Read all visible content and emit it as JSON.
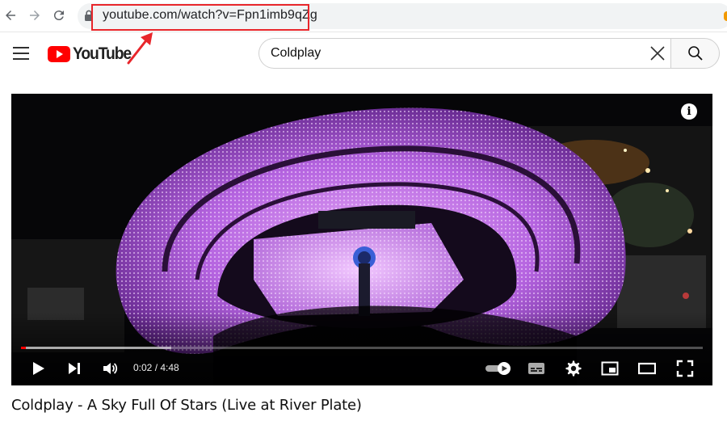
{
  "browser": {
    "url": "youtube.com/watch?v=Fpn1imb9qZg",
    "highlight_color": "#e8262b"
  },
  "header": {
    "logo_text": "YouTube",
    "brand_color": "#ff0000",
    "search": {
      "value": "Coldplay"
    }
  },
  "player": {
    "current_time": "0:02",
    "duration": "4:48",
    "time_display": "0:02 / 4:48",
    "progress_fraction": 0.007,
    "buffered_fraction": 0.22,
    "info_glyph": "i",
    "controls": [
      "play-icon",
      "next-icon",
      "volume-icon",
      "autoplay-toggle-icon",
      "subtitles-icon",
      "settings-icon",
      "miniplayer-icon",
      "theater-mode-icon",
      "fullscreen-icon"
    ]
  },
  "video": {
    "title": "Coldplay - A Sky Full Of Stars (Live at River Plate)"
  }
}
